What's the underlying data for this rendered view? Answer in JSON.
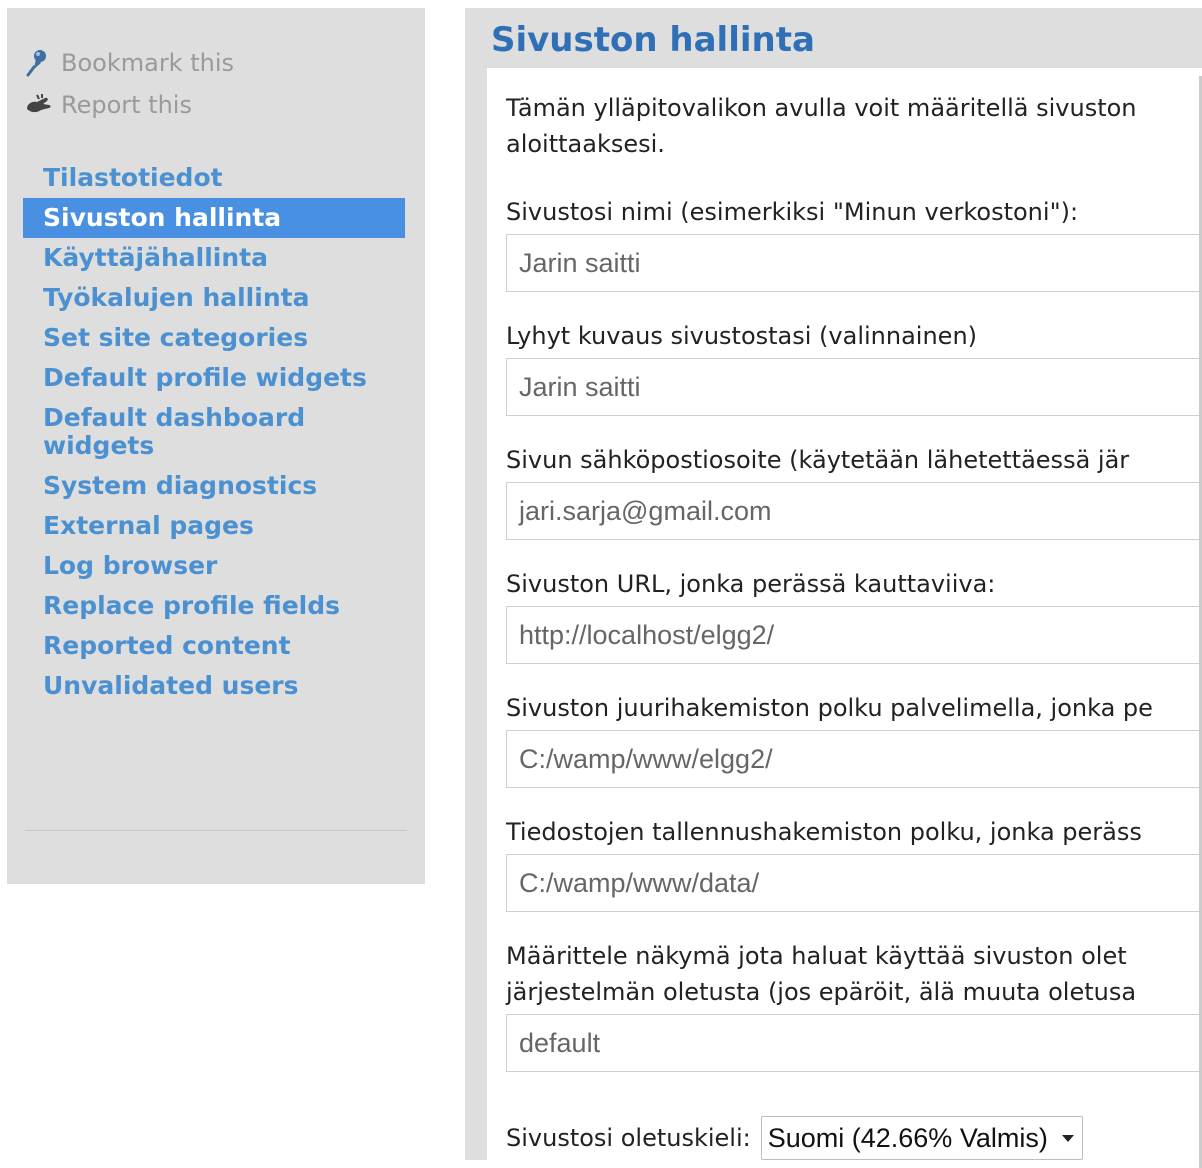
{
  "sidebar": {
    "bookmark_label": "Bookmark this",
    "report_label": "Report this",
    "menu": [
      {
        "label": "Tilastotiedot",
        "active": false
      },
      {
        "label": "Sivuston hallinta",
        "active": true
      },
      {
        "label": "Käyttäjähallinta",
        "active": false
      },
      {
        "label": "Työkalujen hallinta",
        "active": false
      },
      {
        "label": "Set site categories",
        "active": false
      },
      {
        "label": "Default profile widgets",
        "active": false
      },
      {
        "label": "Default dashboard widgets",
        "active": false
      },
      {
        "label": "System diagnostics",
        "active": false
      },
      {
        "label": "External pages",
        "active": false
      },
      {
        "label": "Log browser",
        "active": false
      },
      {
        "label": "Replace profile fields",
        "active": false
      },
      {
        "label": "Reported content",
        "active": false
      },
      {
        "label": "Unvalidated users",
        "active": false
      }
    ]
  },
  "main": {
    "title": "Sivuston hallinta",
    "intro_line1": "Tämän ylläpitovalikon avulla voit määritellä sivuston",
    "intro_line2": "aloittaaksesi.",
    "fields": [
      {
        "label": "Sivustosi nimi (esimerkiksi \"Minun verkostoni\"):",
        "value": "Jarin saitti"
      },
      {
        "label": "Lyhyt kuvaus sivustostasi (valinnainen)",
        "value": "Jarin saitti"
      },
      {
        "label": "Sivun sähköpostiosoite (käytetään lähetettäessä jär",
        "value": "jari.sarja@gmail.com"
      },
      {
        "label": "Sivuston URL, jonka perässä kauttaviiva:",
        "value": "http://localhost/elgg2/"
      },
      {
        "label": "Sivuston juurihakemiston polku palvelimella, jonka pe",
        "value": "C:/wamp/www/elgg2/"
      },
      {
        "label": "Tiedostojen tallennushakemiston polku, jonka peräss",
        "value": "C:/wamp/www/data/"
      }
    ],
    "view_field": {
      "label_line1": "Määrittele näkymä jota haluat käyttää sivuston olet",
      "label_line2": "järjestelmän oletusta (jos epäröit, älä muuta oletusa",
      "value": "default"
    },
    "language": {
      "label": "Sivustosi oletuskieli:",
      "selected": "Suomi (42.66% Valmis)"
    }
  },
  "colors": {
    "link": "#4b90d1",
    "active_bg": "#4a90e2",
    "title": "#2f6fb5",
    "panel_bg": "#dedede"
  },
  "icons": {
    "bookmark": "pushpin-icon",
    "report": "hand-icon",
    "dropdown": "caret-down-icon"
  }
}
